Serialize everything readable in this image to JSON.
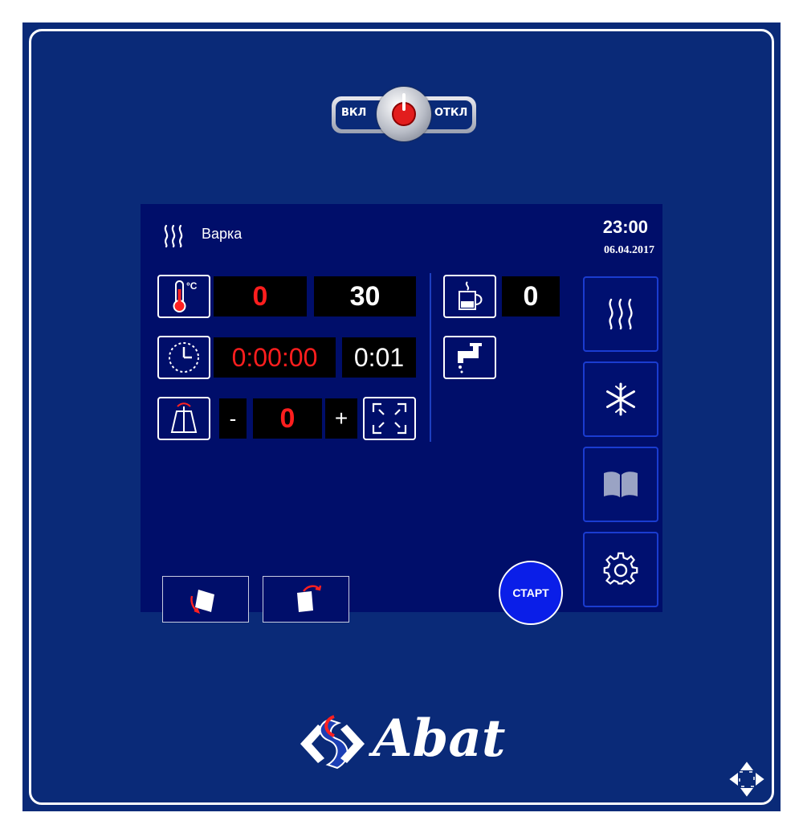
{
  "power_switch": {
    "on_label": "ВКЛ",
    "off_label": "ОТКЛ"
  },
  "screen": {
    "mode": {
      "icon": "steam-icon",
      "label": "Варка"
    },
    "clock": {
      "time": "23:00",
      "date": "06.04.2017"
    },
    "temperature": {
      "icon": "thermometer-icon",
      "unit": "°C",
      "current": "0",
      "set": "30"
    },
    "timer": {
      "icon": "clock-icon",
      "elapsed": "0:00:00",
      "set": "0:01"
    },
    "fan": {
      "icon": "fan-speed-icon",
      "minus": "-",
      "value": "0",
      "plus": "+",
      "fullscreen_icon": "expand-icon"
    },
    "humidity": {
      "icon": "cup-icon",
      "value": "0"
    },
    "water": {
      "icon": "faucet-icon"
    },
    "sidebar": [
      {
        "name": "steam",
        "icon": "steam-icon"
      },
      {
        "name": "cooling",
        "icon": "snowflake-icon"
      },
      {
        "name": "recipes",
        "icon": "book-icon"
      },
      {
        "name": "settings",
        "icon": "gear-icon"
      }
    ],
    "start_label": "СТАРТ",
    "bottom_buttons": [
      {
        "name": "rotate-left",
        "icon": "container-rotate-left-icon"
      },
      {
        "name": "rotate-right",
        "icon": "container-rotate-right-icon"
      }
    ]
  },
  "brand": {
    "logo_text": "Abat"
  },
  "colors": {
    "panel": "#0a2a78",
    "screen": "#000e6a",
    "accent_red": "#ff1e1e",
    "start_blue": "#0a1ee8"
  }
}
